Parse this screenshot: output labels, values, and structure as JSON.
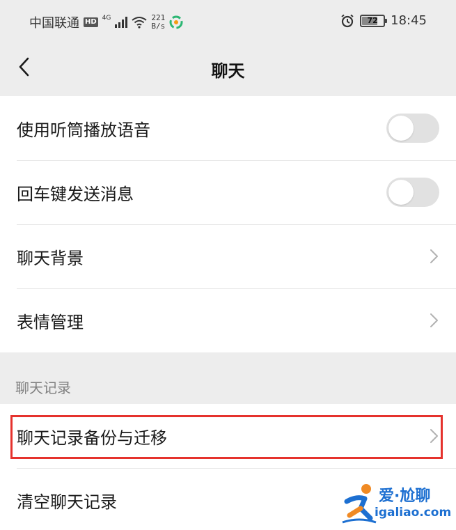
{
  "status_bar": {
    "carrier": "中国联通",
    "hd": "HD",
    "network": "4G",
    "speed_value": "221",
    "speed_unit": "B/s",
    "battery": "72",
    "time": "18:45"
  },
  "nav": {
    "title": "聊天"
  },
  "settings_group": {
    "items": [
      {
        "label": "使用听筒播放语音",
        "control": "toggle",
        "on": false
      },
      {
        "label": "回车键发送消息",
        "control": "toggle",
        "on": false
      },
      {
        "label": "聊天背景",
        "control": "chevron"
      },
      {
        "label": "表情管理",
        "control": "chevron"
      }
    ]
  },
  "history_section": {
    "header": "聊天记录",
    "items": [
      {
        "label": "聊天记录备份与迁移",
        "control": "chevron",
        "highlighted": true
      },
      {
        "label": "清空聊天记录",
        "control": "none"
      }
    ]
  },
  "watermark": {
    "brand": "爱·尬聊",
    "url": "igaliao.com"
  },
  "colors": {
    "background": "#ededed",
    "toggle_off": "#e1e1e1",
    "highlight_border": "#e5322d",
    "watermark_blue": "#1c6fd1",
    "watermark_orange": "#f08a24"
  }
}
